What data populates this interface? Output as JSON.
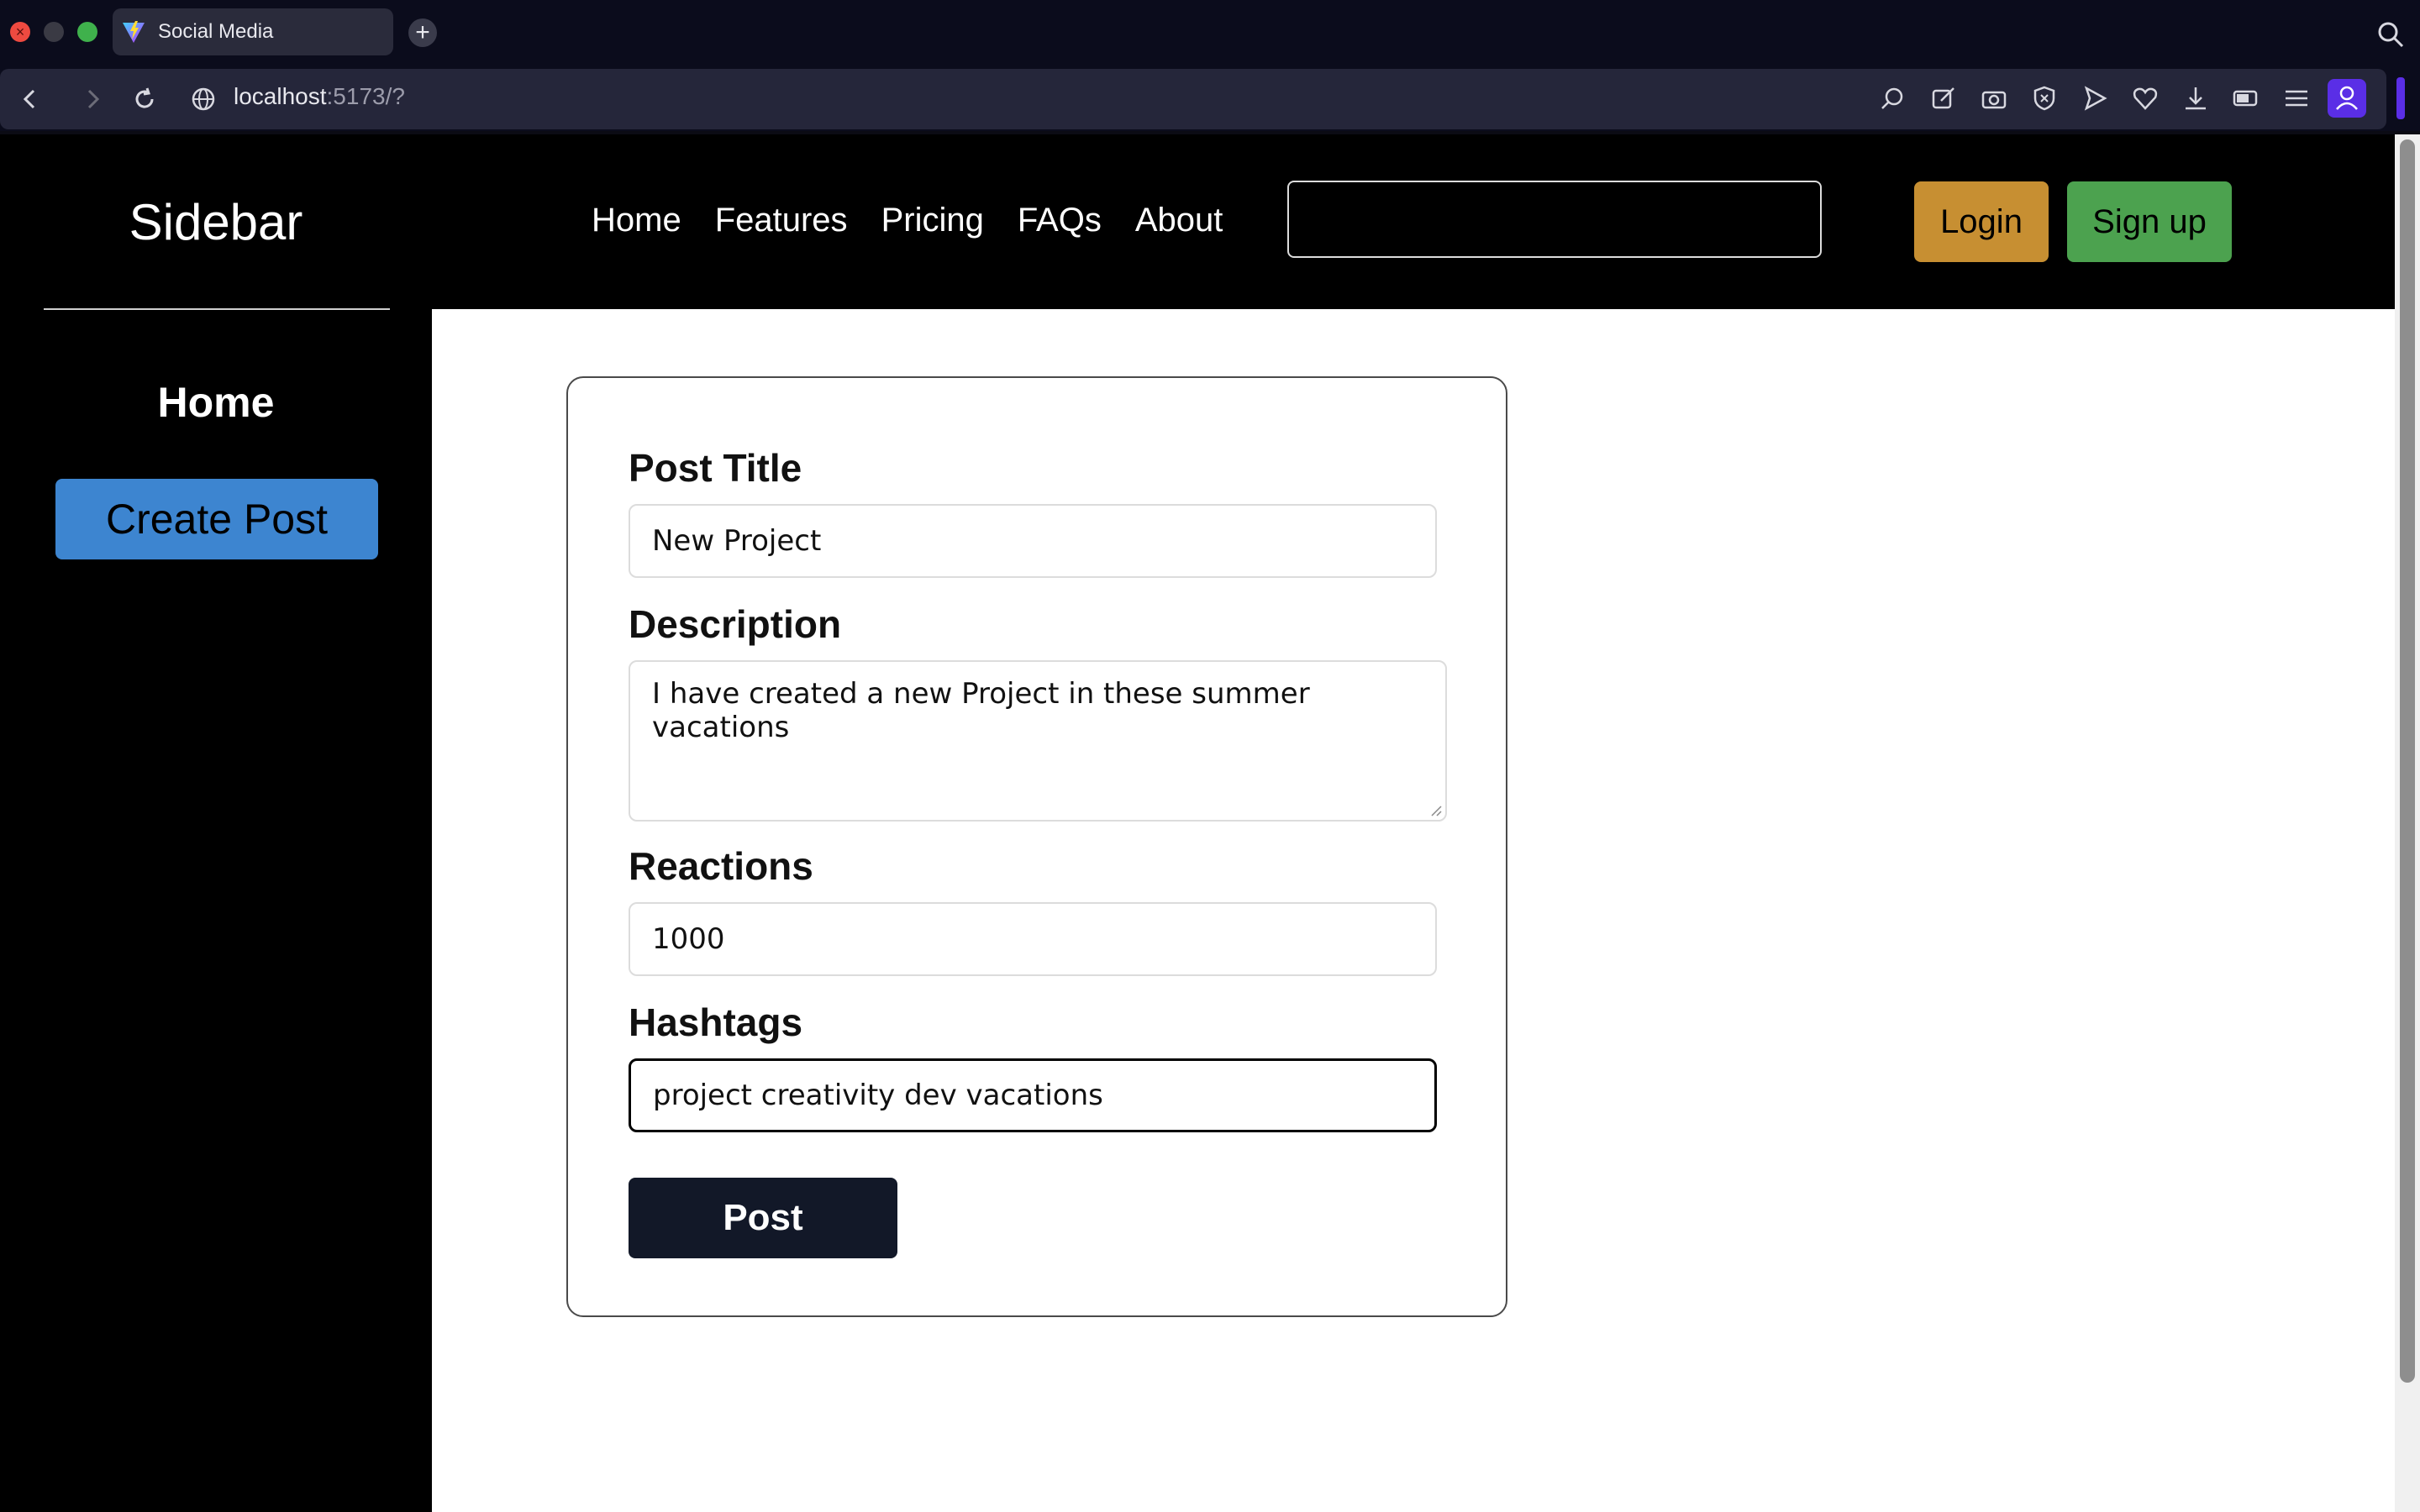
{
  "browser": {
    "tab_title": "Social Media",
    "new_tab_label": "+",
    "url_host": "localhost",
    "url_rest": ":5173/?"
  },
  "sidebar": {
    "brand": "Sidebar",
    "home_label": "Home",
    "create_post_label": "Create Post"
  },
  "header": {
    "nav": [
      "Home",
      "Features",
      "Pricing",
      "FAQs",
      "About"
    ],
    "search_value": "",
    "login_label": "Login",
    "signup_label": "Sign up"
  },
  "form": {
    "title_label": "Post Title",
    "title_value": "New Project",
    "description_label": "Description",
    "description_value": "I have created a new Project in these summer vacations",
    "reactions_label": "Reactions",
    "reactions_value": "1000",
    "hashtags_label": "Hashtags",
    "hashtags_value": "project creativity dev vacations",
    "submit_label": "Post"
  },
  "colors": {
    "create_post_bg": "#3d85d0",
    "login_bg": "#c78f32",
    "signup_bg": "#4ca24f",
    "post_btn_bg": "#121828",
    "profile_accent": "#5a2ee6"
  }
}
